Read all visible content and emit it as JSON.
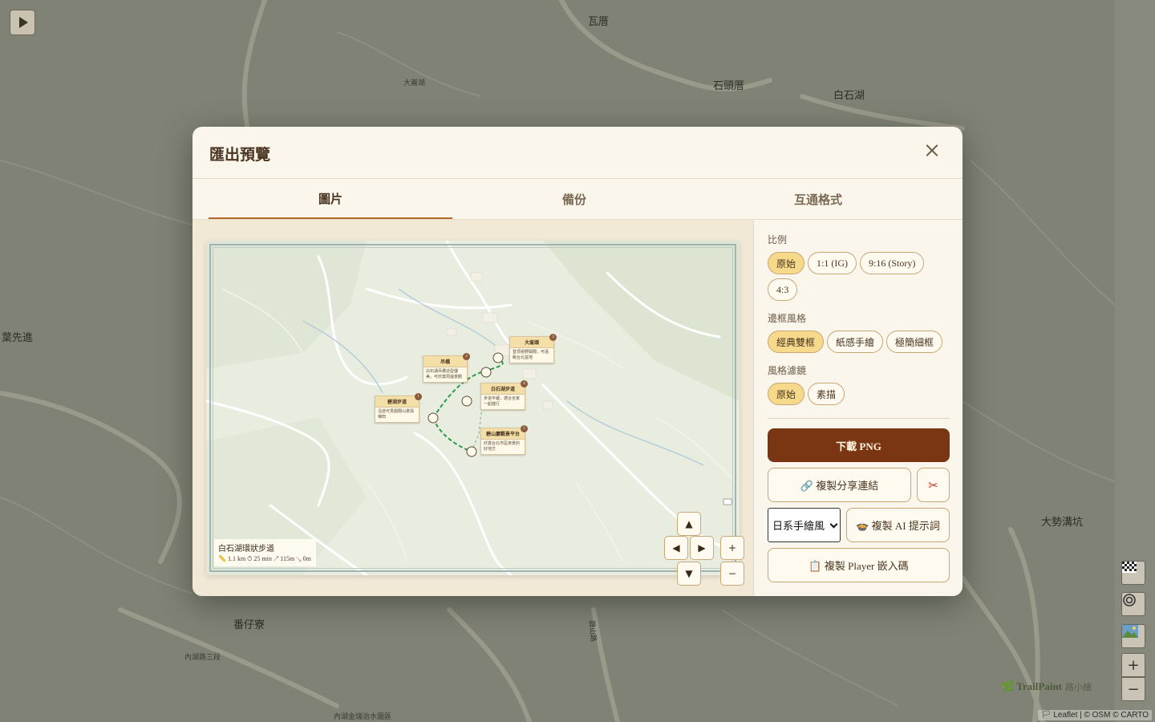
{
  "background_map": {
    "labels": [
      "瓦厝",
      "石頭厝",
      "白石湖",
      "大崙湖",
      "葉先進",
      "番仔寮",
      "內湖路三段",
      "大勢溝坑",
      "內湖金瑞治水園區",
      "碧山路"
    ],
    "attribution": "🏳 Leaflet | © OSM © CARTO",
    "brand": "TrailPaint",
    "brand_sub": "路小繪"
  },
  "map_controls": {
    "zoom_in": "+",
    "zoom_out": "−"
  },
  "modal": {
    "title": "匯出預覽",
    "tabs": [
      {
        "label": "圖片",
        "active": true
      },
      {
        "label": "備份",
        "active": false
      },
      {
        "label": "互通格式",
        "active": false
      }
    ]
  },
  "preview": {
    "route_title": "白石湖環狀步道",
    "route_stats": "📏 1.1 km  ⏱ 25 min  ↗ 115m  ↘ 0m",
    "cards": [
      {
        "num": "1",
        "title": "碧湖步道",
        "body": "沿途可見開闊山景與梯田"
      },
      {
        "num": "2",
        "title": "吊橋",
        "body": "白石湖吊橋造型優美，可欣賞周邊景觀"
      },
      {
        "num": "3",
        "title": "大崙頭",
        "body": "登頂視野開闊，可遠眺台北盆地"
      },
      {
        "num": "4",
        "title": "白石湖步道",
        "body": "步道平緩，適合全家一起健行"
      },
      {
        "num": "5",
        "title": "碧山巖觀景平台",
        "body": "欣賞台北市區夜景的好地方"
      }
    ],
    "nav": {
      "up": "▲",
      "down": "▼",
      "left": "◀",
      "right": "▶",
      "zoom_in": "+",
      "zoom_out": "−"
    }
  },
  "settings": {
    "ratio_label": "比例",
    "ratios": [
      {
        "label": "原始",
        "active": true
      },
      {
        "label": "1:1 (IG)",
        "active": false
      },
      {
        "label": "9:16 (Story)",
        "active": false
      },
      {
        "label": "4:3",
        "active": false
      }
    ],
    "frame_label": "邊框風格",
    "frames": [
      {
        "label": "經典雙框",
        "active": true
      },
      {
        "label": "紙感手繪",
        "active": false
      },
      {
        "label": "極簡細框",
        "active": false
      }
    ],
    "filter_label": "風格濾鏡",
    "filters": [
      {
        "label": "原始",
        "active": true
      },
      {
        "label": "素描",
        "active": false
      }
    ],
    "download_label": "下載 PNG",
    "share_label": "🔗 複製分享連結",
    "cut_icon": "✂",
    "style_select": "日系手繪風",
    "ai_prompt_label": "🍲 複製 AI 提示詞",
    "player_embed_label": "📋 複製 Player 嵌入碼"
  }
}
